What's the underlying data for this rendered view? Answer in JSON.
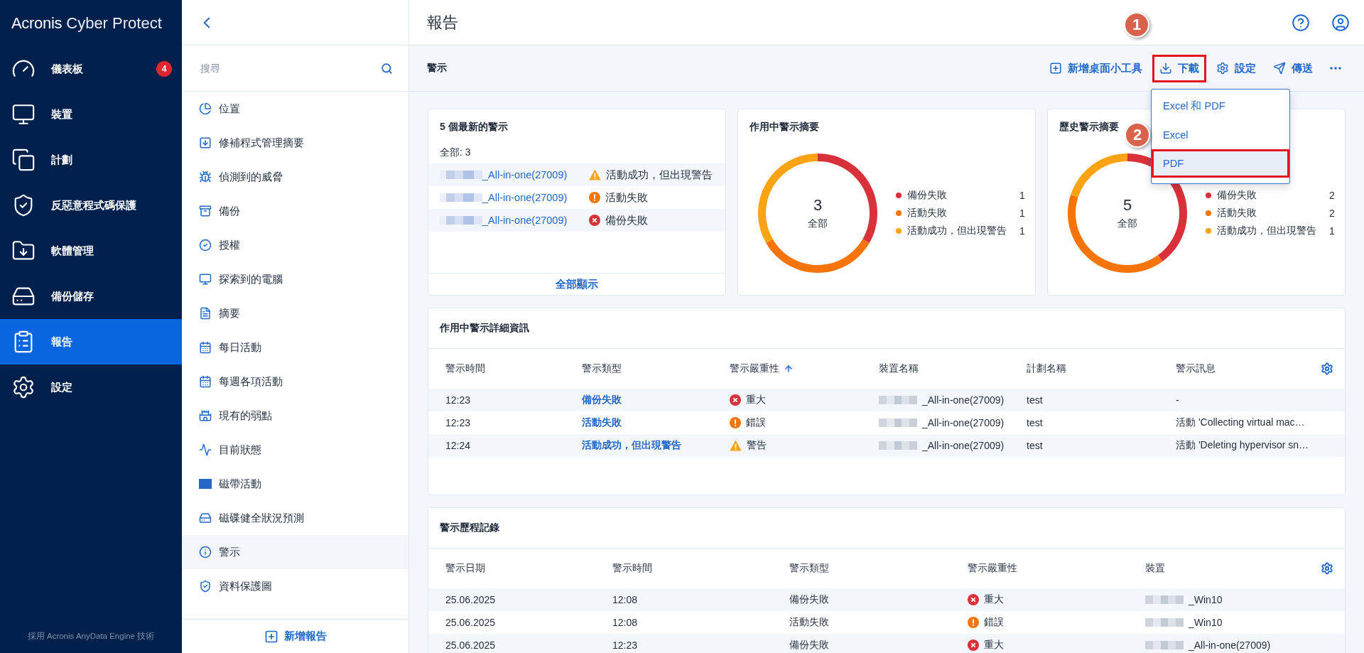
{
  "brand": {
    "name": "Acronis",
    "product": "Cyber Protect"
  },
  "nav": [
    {
      "label": "儀表板",
      "selected": false,
      "badge": "4"
    },
    {
      "label": "裝置",
      "selected": false
    },
    {
      "label": "計劃",
      "selected": false
    },
    {
      "label": "反惡意程式碼保護",
      "selected": false
    },
    {
      "label": "軟體管理",
      "selected": false
    },
    {
      "label": "備份儲存",
      "selected": false
    },
    {
      "label": "報告",
      "selected": true
    },
    {
      "label": "設定",
      "selected": false
    }
  ],
  "nav_footer": "採用 Acronis AnyData Engine 技術",
  "reports_panel": {
    "search": {
      "placeholder": "搜尋"
    },
    "items": [
      {
        "label": "位置",
        "selected": false
      },
      {
        "label": "修補程式管理摘要",
        "selected": false
      },
      {
        "label": "偵測到的威脅",
        "selected": false
      },
      {
        "label": "備份",
        "selected": false
      },
      {
        "label": "授權",
        "selected": false
      },
      {
        "label": "探索到的電腦",
        "selected": false
      },
      {
        "label": "摘要",
        "selected": false
      },
      {
        "label": "每日活動",
        "selected": false
      },
      {
        "label": "每週各項活動",
        "selected": false
      },
      {
        "label": "現有的弱點",
        "selected": false
      },
      {
        "label": "目前狀態",
        "selected": false
      },
      {
        "label": "磁帶活動",
        "selected": false
      },
      {
        "label": "磁碟健全狀況預測",
        "selected": false
      },
      {
        "label": "警示",
        "selected": true
      },
      {
        "label": "資料保護圖",
        "selected": false
      }
    ],
    "add_button": "新增報告"
  },
  "page": {
    "title": "報告"
  },
  "toolbar": {
    "title": "警示",
    "actions": [
      {
        "kind": "add",
        "label": "新增桌面小工具",
        "annotated": false
      },
      {
        "kind": "download",
        "label": "下載",
        "annotated": true,
        "callout": "1"
      },
      {
        "kind": "settings",
        "label": "設定",
        "annotated": false
      },
      {
        "kind": "send",
        "label": "傳送",
        "annotated": false
      },
      {
        "kind": "more",
        "annotated": false
      }
    ]
  },
  "download_menu": {
    "callout": "2",
    "items": [
      {
        "label": "Excel 和 PDF",
        "selected": false,
        "annotated": false
      },
      {
        "label": "Excel",
        "selected": false,
        "annotated": false
      },
      {
        "label": "PDF",
        "selected": true,
        "annotated": true
      }
    ]
  },
  "latest_alerts": {
    "title": "5 個最新的警示",
    "total": "全部: 3",
    "rows": [
      {
        "device": "_All-in-one(27009)",
        "kind": "warning",
        "status": "活動成功，但出現警告"
      },
      {
        "device": "_All-in-one(27009)",
        "kind": "error",
        "status": "活動失敗"
      },
      {
        "device": "_All-in-one(27009)",
        "kind": "critical",
        "status": "備份失敗"
      }
    ],
    "show_all": "全部顯示"
  },
  "active_summary": {
    "title": "作用中警示摘要",
    "center_value": "3",
    "center_label": "全部",
    "legend": [
      {
        "count": "1",
        "color": "#d9313a"
      },
      {
        "count": "1",
        "color": "#f77408"
      },
      {
        "count": "1",
        "color": "#fca313"
      }
    ],
    "chart_data": {
      "type": "donut",
      "categories": [
        "備份失敗",
        "活動失敗",
        "活動成功，但出現警告"
      ],
      "values": [
        33.33,
        33.33,
        33.34
      ]
    }
  },
  "history_summary": {
    "title": "歷史警示摘要",
    "center_value": "5",
    "center_label": "全部",
    "legend": [
      {
        "count": "2",
        "color": "#d9313a"
      },
      {
        "count": "2",
        "color": "#f77408"
      },
      {
        "count": "1",
        "color": "#fca313"
      }
    ],
    "chart_data": {
      "type": "donut",
      "categories": [
        "備份失敗",
        "活動失敗",
        "活動成功，但出現警告"
      ],
      "values": [
        40,
        40,
        20
      ]
    }
  },
  "active_details": {
    "title": "作用中警示詳細資訊",
    "columns": [
      {
        "label": "警示時間",
        "sorted": false
      },
      {
        "label": "警示類型",
        "sorted": false
      },
      {
        "label": "警示嚴重性",
        "sorted": true
      },
      {
        "label": "裝置名稱",
        "sorted": false
      },
      {
        "label": "計劃名稱",
        "sorted": false
      },
      {
        "label": "警示訊息",
        "sorted": false
      }
    ],
    "rows": [
      {
        "time": "12:23",
        "type": "備份失敗",
        "kind": "critical",
        "severity": "重大",
        "device": "_All-in-one(27009)",
        "plan": "test",
        "message": "-"
      },
      {
        "time": "12:23",
        "type": "活動失敗",
        "kind": "error",
        "severity": "錯誤",
        "device": "_All-in-one(27009)",
        "plan": "test",
        "message": "活動 'Collecting virtual mac…"
      },
      {
        "time": "12:24",
        "type": "活動成功，但出現警告",
        "kind": "warning",
        "severity": "警告",
        "device": "_All-in-one(27009)",
        "plan": "test",
        "message": "活動 'Deleting hypervisor sn…"
      }
    ]
  },
  "alert_history": {
    "title": "警示歷程記錄",
    "columns": [
      {
        "label": "警示日期"
      },
      {
        "label": "警示時間"
      },
      {
        "label": "警示類型"
      },
      {
        "label": "警示嚴重性"
      },
      {
        "label": "裝置"
      }
    ],
    "rows": [
      {
        "date": "25.06.2025",
        "time": "12:08",
        "type": "備份失敗",
        "kind": "critical",
        "severity": "重大",
        "device": "_Win10"
      },
      {
        "date": "25.06.2025",
        "time": "12:08",
        "type": "活動失敗",
        "kind": "error",
        "severity": "錯誤",
        "device": "_Win10"
      },
      {
        "date": "25.06.2025",
        "time": "12:23",
        "type": "備份失敗",
        "kind": "critical",
        "severity": "重大",
        "device": "_All-in-one(27009)"
      }
    ]
  }
}
